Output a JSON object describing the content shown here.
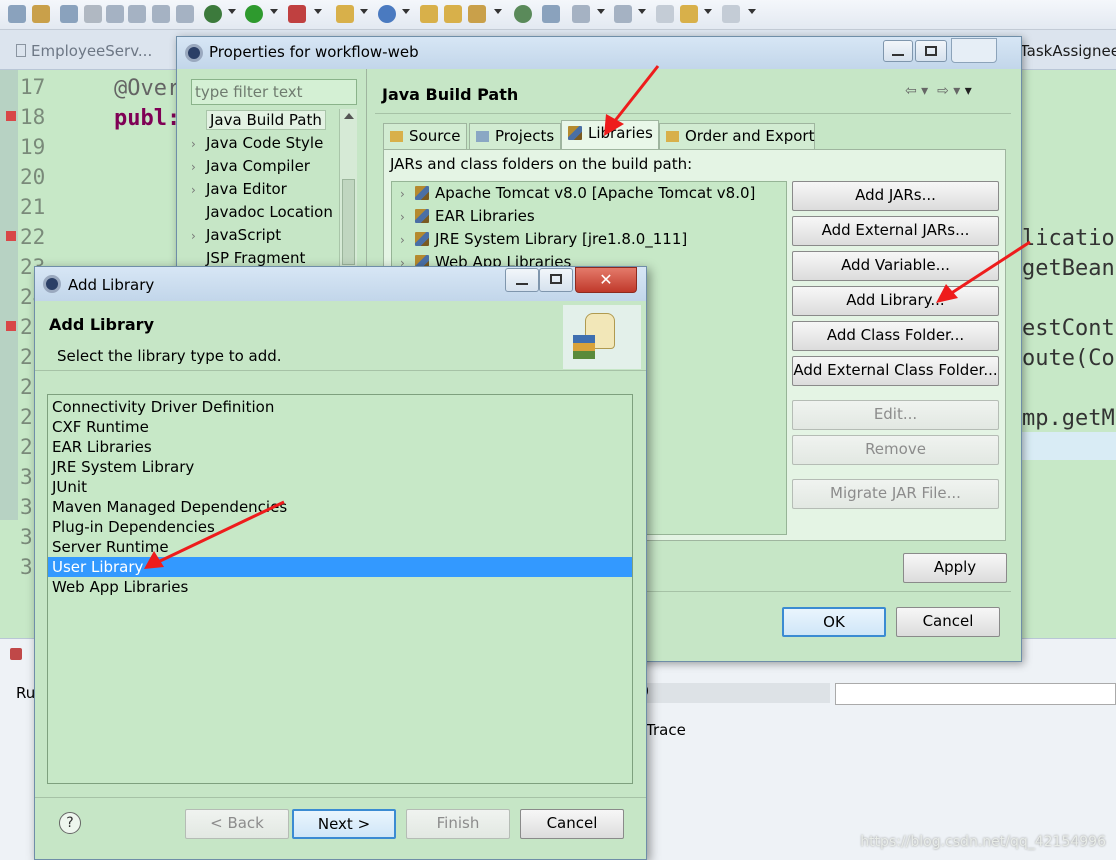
{
  "editor": {
    "tab_label": "EmployeeServ...",
    "right_tab_label": "TaskAssignee...",
    "line_numbers": [
      "17",
      "18",
      "19",
      "20",
      "21",
      "22",
      "23",
      "24",
      "25",
      "26",
      "27",
      "28",
      "29",
      "30",
      "31",
      "32",
      "33"
    ],
    "code_annotation": "@Over",
    "code_public": "publ:",
    "code_right": [
      "licatio",
      "getBean(",
      "estConte",
      "oute(Cor",
      "mp.getM"
    ],
    "bottom_left_label": "Ru",
    "bottom_trace_label": "Trace",
    "bottom_number": "0"
  },
  "properties_dialog": {
    "title": "Properties for workflow-web",
    "filter_placeholder": "type filter text",
    "tree_items": [
      {
        "label": "Java Build Path",
        "caret": ""
      },
      {
        "label": "Java Code Style",
        "caret": "›"
      },
      {
        "label": "Java Compiler",
        "caret": "›"
      },
      {
        "label": "Java Editor",
        "caret": "›"
      },
      {
        "label": "Javadoc Location",
        "caret": ""
      },
      {
        "label": "JavaScript",
        "caret": "›"
      },
      {
        "label": "JSP Fragment",
        "caret": ""
      }
    ],
    "page_title": "Java Build Path",
    "tabs": [
      "Source",
      "Projects",
      "Libraries",
      "Order and Export"
    ],
    "active_tab": "Libraries",
    "build_path_caption": "JARs and class folders on the build path:",
    "libraries": [
      "Apache Tomcat v8.0 [Apache Tomcat v8.0]",
      "EAR Libraries",
      "JRE System Library [jre1.8.0_111]",
      "Web App Libraries"
    ],
    "buttons": {
      "add_jars": "Add JARs...",
      "add_external_jars": "Add External JARs...",
      "add_variable": "Add Variable...",
      "add_library": "Add Library...",
      "add_class_folder": "Add Class Folder...",
      "add_external_class_folder": "Add External Class Folder...",
      "edit": "Edit...",
      "remove": "Remove",
      "migrate_jar": "Migrate JAR File...",
      "apply": "Apply",
      "ok": "OK",
      "cancel": "Cancel"
    }
  },
  "add_library_dialog": {
    "title": "Add Library",
    "header_title": "Add Library",
    "header_subtitle": "Select the library type to add.",
    "library_types": [
      "Connectivity Driver Definition",
      "CXF Runtime",
      "EAR Libraries",
      "JRE System Library",
      "JUnit",
      "Maven Managed Dependencies",
      "Plug-in Dependencies",
      "Server Runtime",
      "User Library",
      "Web App Libraries"
    ],
    "selected_type": "User Library",
    "help_icon_glyph": "?",
    "buttons": {
      "back": "< Back",
      "next": "Next >",
      "finish": "Finish",
      "cancel": "Cancel"
    }
  },
  "watermark": "https://blog.csdn.net/qq_42154996",
  "colors": {
    "accent_arrow": "#ee1c1c",
    "selection": "#3399ff",
    "background_green": "#c7e8c7"
  }
}
